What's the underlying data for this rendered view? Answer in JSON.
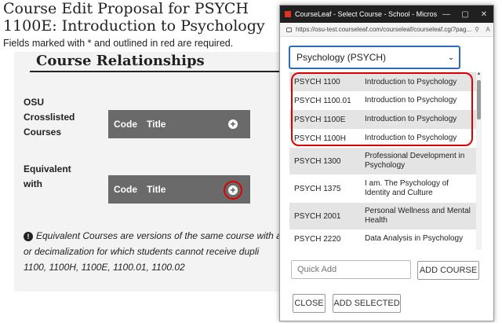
{
  "page": {
    "title": "Course Edit Proposal for PSYCH 1100E: Introduction to Psychology",
    "required_note": "Fields marked with * and outlined in red are required.",
    "section_heading": "Course Relationships",
    "crosslisted": {
      "label_lines": [
        "OSU",
        "Crosslisted",
        "Courses"
      ],
      "code_col": "Code",
      "title_col": "Title"
    },
    "equivalent": {
      "label_lines": [
        "Equivalent",
        "with"
      ],
      "code_col": "Code",
      "title_col": "Title"
    },
    "info_lines": [
      "Equivalent Courses are versions of the same course with a",
      "or decimalization for which students cannot receive dupli",
      "1100, 1100H, 1100E, 1100.01, 1100.02"
    ]
  },
  "popup": {
    "window_title": "CourseLeaf - Select Course - School - Microsoft Ed...",
    "window_buttons": [
      "—",
      "▢",
      "✕"
    ],
    "url": "https://osu-test.courseleaf.com/courseleaf/courseleaf.cgi?pag...",
    "subject_select": "Psychology (PSYCH)",
    "courses": [
      {
        "code": "PSYCH 1100",
        "title": "Introduction to Psychology"
      },
      {
        "code": "PSYCH 1100.01",
        "title": "Introduction to Psychology"
      },
      {
        "code": "PSYCH 1100E",
        "title": "Introduction to Psychology"
      },
      {
        "code": "PSYCH 1100H",
        "title": "Introduction to Psychology"
      },
      {
        "code": "PSYCH 1300",
        "title": "Professional Development in Psychology"
      },
      {
        "code": "PSYCH 1375",
        "title": "I am. The Psychology of Identity and Culture"
      },
      {
        "code": "PSYCH 2001",
        "title": "Personal Wellness and Mental Health"
      },
      {
        "code": "PSYCH 2220",
        "title": "Data Analysis in Psychology"
      }
    ],
    "quick_add_placeholder": "Quick Add",
    "add_course_label": "ADD COURSE",
    "close_label": "CLOSE",
    "add_selected_label": "ADD SELECTED"
  },
  "colors": {
    "highlight": "#dd0000",
    "focus": "#2d6ab8",
    "bar": "#6a6a6a"
  }
}
